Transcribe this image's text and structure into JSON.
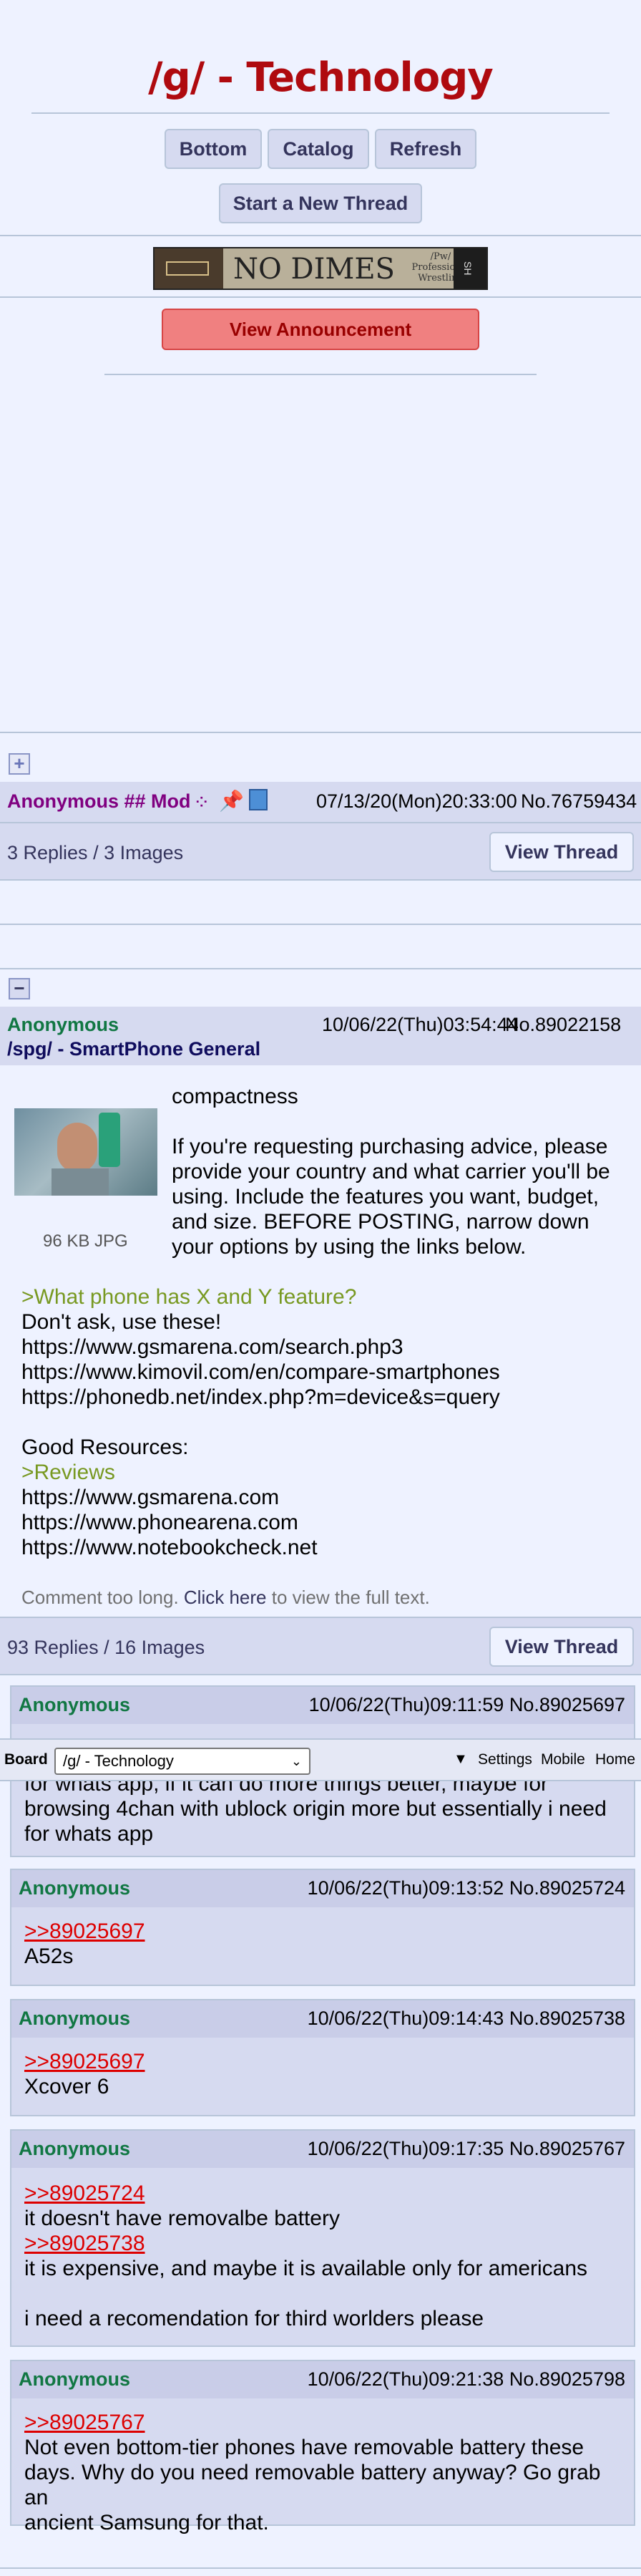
{
  "board": {
    "title": "/g/ - Technology"
  },
  "nav": {
    "bottom": "Bottom",
    "catalog": "Catalog",
    "refresh": "Refresh",
    "new_thread": "Start a New Thread"
  },
  "banner": {
    "text": "NO DIMES",
    "sub": "/Pw/ Professional Wrestling",
    "badge": "SH"
  },
  "announcement": {
    "label": "View Announcement"
  },
  "sticky": {
    "expand_icon": "+",
    "name": "Anonymous ## Mod",
    "datetime": "07/13/20(Mon)20:33:00",
    "number": "No.76759434",
    "reply_summary": "3 Replies / 3 Images",
    "view_thread": "View Thread"
  },
  "op": {
    "collapse_icon": "−",
    "name": "Anonymous",
    "datetime": "10/06/22(Thu)03:54:44",
    "number": "No.89022158",
    "subject": "/spg/ - SmartPhone General",
    "file_info": "96 KB JPG",
    "intro": "compactness",
    "para1": [
      "If you're requesting purchasing advice, please",
      "provide your country and what carrier you'll be",
      "using. Include the features you want, budget,",
      "and size. BEFORE POSTING, narrow down",
      "your options by using the links below."
    ],
    "greentext1": ">What phone has X and Y feature?",
    "line_dontask": "Don't ask, use these!",
    "links1": [
      "https://www.gsmarena.com/search.php3",
      "https://www.kimovil.com/en/compare-smartphones",
      "https://phonedb.net/index.php?m=device&s=query"
    ],
    "good_resources": "Good Resources:",
    "greentext2": ">Reviews",
    "links2": [
      "https://www.gsmarena.com",
      "https://www.phonearena.com",
      "https://www.notebookcheck.net"
    ],
    "too_long_prefix": "Comment too long.",
    "click_here": "Click here",
    "too_long_suffix": "to view the full text.",
    "reply_summary": "93 Replies / 16 Images",
    "view_thread": "View Thread"
  },
  "replies": [
    {
      "name": "Anonymous",
      "datetime": "10/06/22(Thu)09:11:59",
      "number": "No.89025697",
      "lines": [
        "for whats app, if it can do more things better, maybe for",
        "browsing 4chan with ublock origin more but essentially i need",
        "for whats app"
      ]
    },
    {
      "name": "Anonymous",
      "datetime": "10/06/22(Thu)09:13:52",
      "number": "No.89025724",
      "quote": ">>89025697",
      "lines": [
        "A52s"
      ]
    },
    {
      "name": "Anonymous",
      "datetime": "10/06/22(Thu)09:14:43",
      "number": "No.89025738",
      "quote": ">>89025697",
      "lines": [
        "Xcover 6"
      ]
    },
    {
      "name": "Anonymous",
      "datetime": "10/06/22(Thu)09:17:35",
      "number": "No.89025767",
      "quote": ">>89025724",
      "line1": "it doesn't have removalbe battery",
      "quote2": ">>89025738",
      "line2": "it is expensive, and maybe it is available only for americans",
      "line3": "i need a recomendation for third worlders please"
    },
    {
      "name": "Anonymous",
      "datetime": "10/06/22(Thu)09:21:38",
      "number": "No.89025798",
      "quote": ">>89025767",
      "lines": [
        "Not even bottom-tier phones have removable battery these",
        "days. Why do you need removable battery anyway? Go grab an",
        "ancient Samsung for that."
      ]
    }
  ],
  "bottom_bar": {
    "board_label": "Board",
    "select_value": "/g/ - Technology",
    "arrow": "▼",
    "settings": "Settings",
    "mobile": "Mobile",
    "home": "Home"
  },
  "colors": {
    "title": "#af0a0f",
    "name_green": "#117743",
    "greentext": "#789922",
    "quote": "#dd0000",
    "mod_name": "#800080"
  }
}
